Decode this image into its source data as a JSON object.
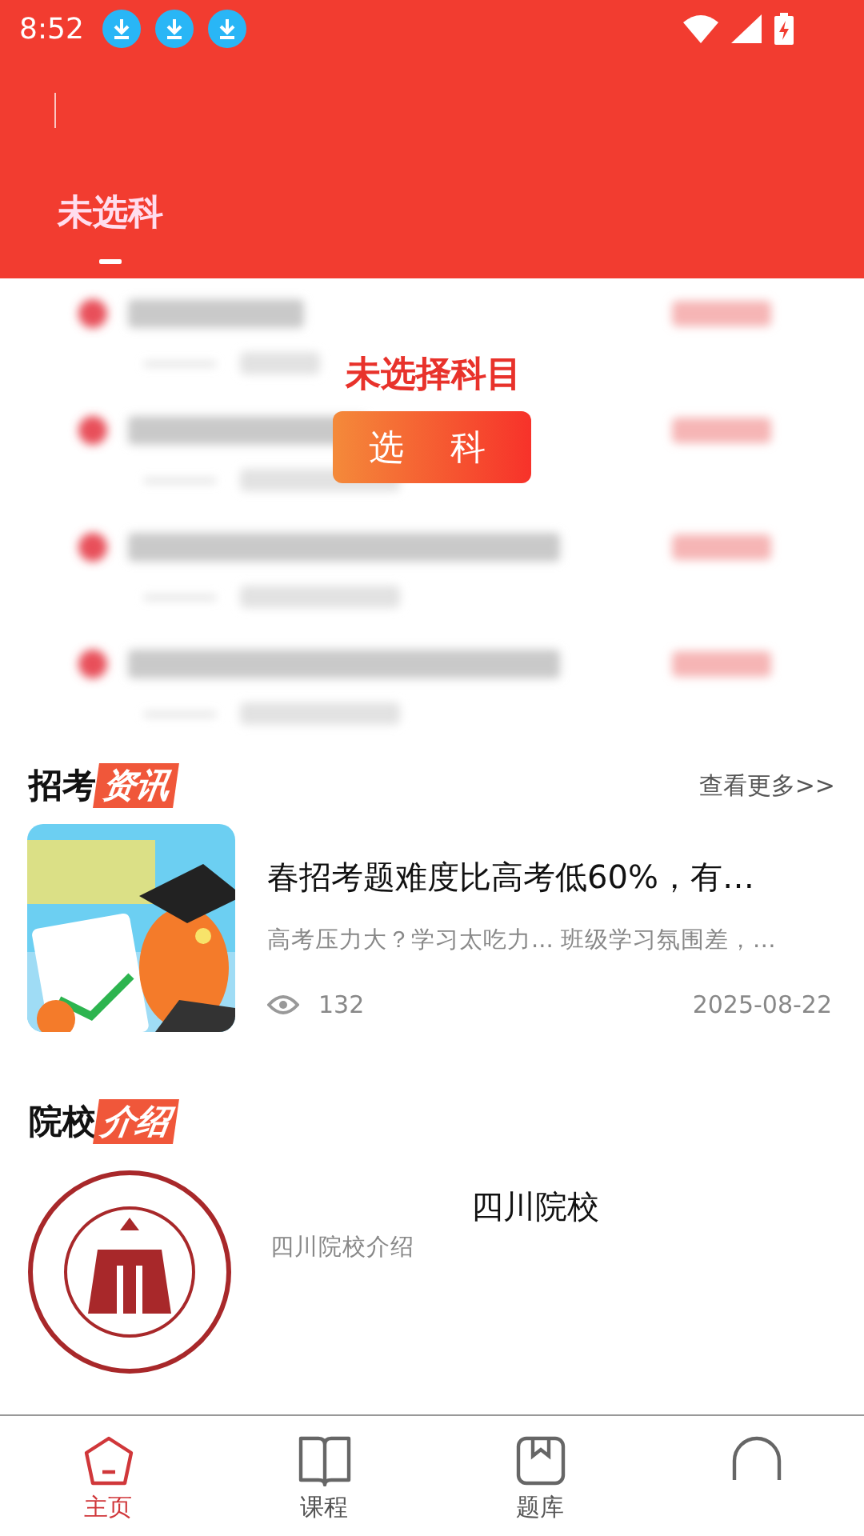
{
  "status_bar": {
    "time": "8:52",
    "notifications": [
      {
        "kind": "download"
      },
      {
        "kind": "download"
      },
      {
        "kind": "download"
      }
    ]
  },
  "tabs": [
    {
      "label": "未选科",
      "selected": true
    }
  ],
  "locked": {
    "message": "未选择科目",
    "button": "选 科"
  },
  "news": {
    "title": "招考",
    "title_tag": "资讯",
    "more": "查看更多>>",
    "articles": [
      {
        "title": "春招考题难度比高考低60%，有…",
        "summary": "高考压力大？学习太吃力... 班级学习氛围差，…",
        "views": "132",
        "date": "2025-08-22"
      }
    ]
  },
  "schools": {
    "title": "院校",
    "title_tag": "介绍",
    "items": [
      {
        "name": "四川院校",
        "description": "四川院校介绍"
      }
    ]
  },
  "nav": [
    {
      "label": "主页",
      "kind": "home",
      "selected": true
    },
    {
      "label": "课程",
      "kind": "book",
      "selected": false
    },
    {
      "label": "题库",
      "kind": "bank",
      "selected": false
    },
    {
      "kind": "profile",
      "selected": false
    }
  ]
}
